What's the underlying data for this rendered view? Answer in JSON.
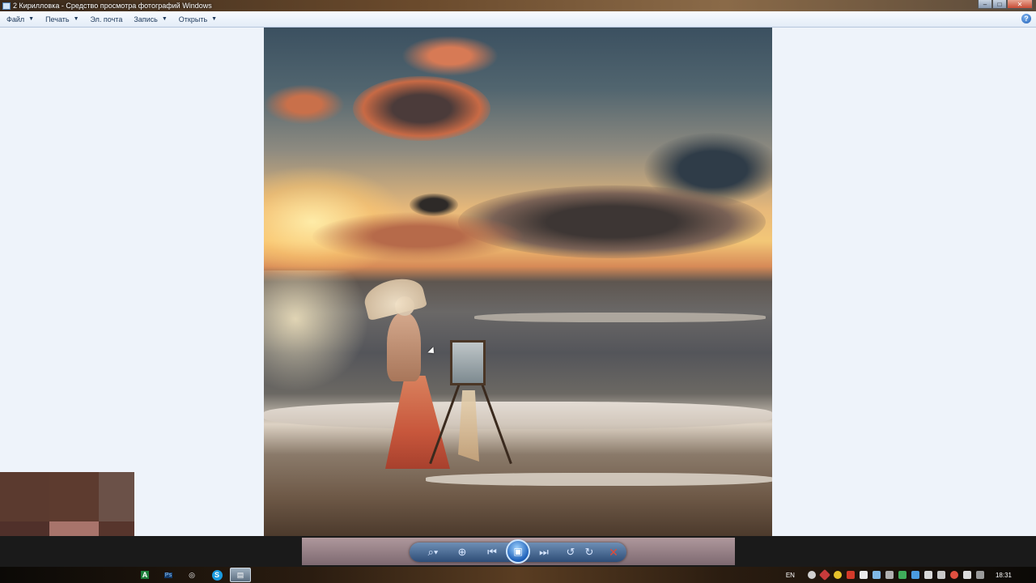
{
  "window": {
    "title": "2 Кирилловка - Средство просмотра фотографий Windows",
    "min_glyph": "–",
    "max_glyph": "□",
    "close_glyph": "✕"
  },
  "menu": {
    "items": [
      {
        "label": "Файл",
        "caret": "▼"
      },
      {
        "label": "Печать",
        "caret": "▼"
      },
      {
        "label": "Эл. почта",
        "caret": ""
      },
      {
        "label": "Запись",
        "caret": "▼"
      },
      {
        "label": "Открыть",
        "caret": "▼"
      }
    ],
    "help_glyph": "?"
  },
  "photo": {
    "icon": "photo-painting-woman-at-sea"
  },
  "controls": {
    "zoom_glyph": "⌕▾",
    "fit_glyph": "⊕",
    "prev_glyph": "⏮",
    "slideshow_glyph": "▣",
    "next_glyph": "⏭",
    "rotate_ccw_glyph": "↺",
    "rotate_cw_glyph": "↻",
    "delete_glyph": "✕"
  },
  "taskbar": {
    "apps": [
      {
        "icon": "excel-icon",
        "glyph": "A",
        "color": "#1e7f3b"
      },
      {
        "icon": "photoshop-icon",
        "glyph": "Ps",
        "color": "#123a6b"
      },
      {
        "icon": "media-icon",
        "glyph": "◎",
        "color": "#222222"
      },
      {
        "icon": "skype-icon",
        "glyph": "S",
        "color": "#1a9be0"
      },
      {
        "icon": "photo-viewer-icon",
        "glyph": "▤",
        "color": "#8aa7c6"
      }
    ],
    "language": "EN",
    "clock": "18:31"
  },
  "colors": {
    "accent": "#1e395b",
    "viewer_bg": "#eef3fa"
  }
}
